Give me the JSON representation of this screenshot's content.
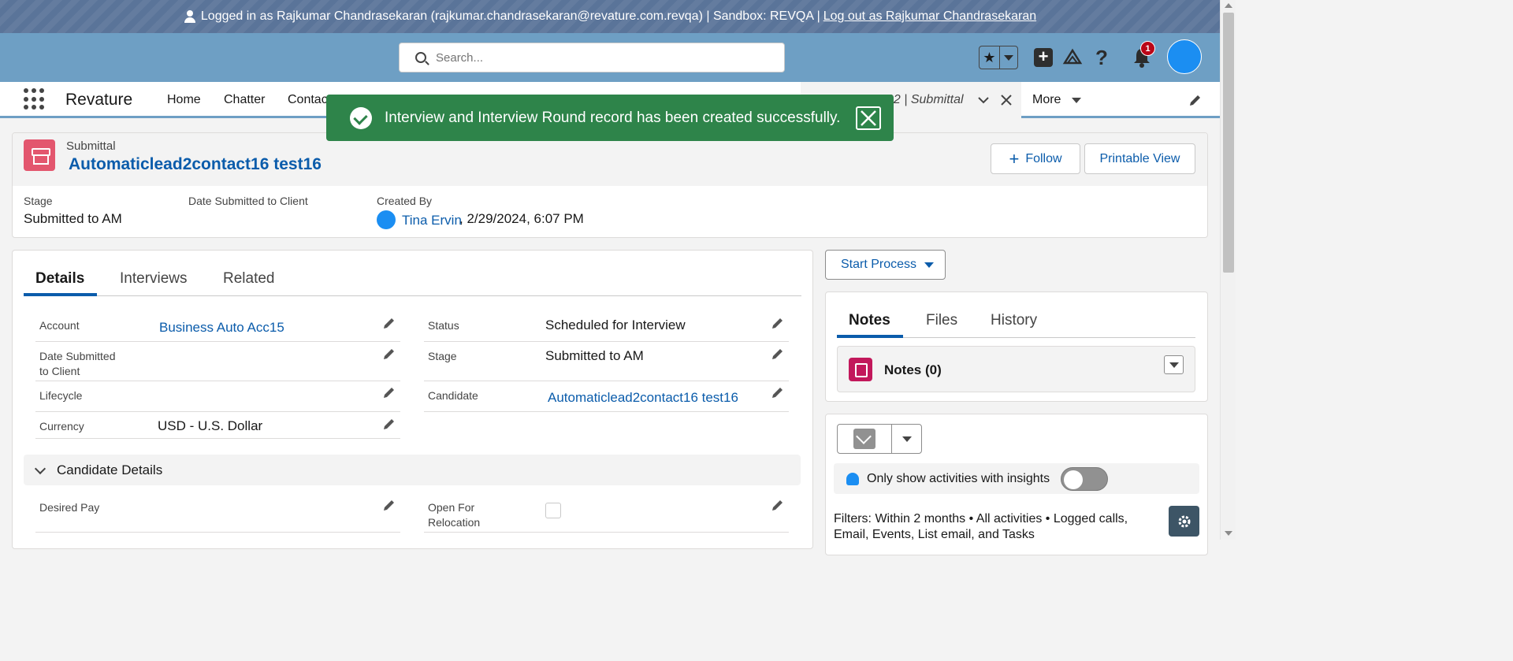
{
  "banner": {
    "text": "Logged in as Rajkumar Chandrasekaran (rajkumar.chandrasekaran@revature.com.revqa) | Sandbox: REVQA |",
    "logout": "Log out as Rajkumar Chandrasekaran"
  },
  "header": {
    "search_placeholder": "Search...",
    "notification_count": "1"
  },
  "nav": {
    "app_name": "Revature",
    "items": [
      "Home",
      "Chatter",
      "Contac"
    ],
    "active_tab": "02 | Submittal",
    "more": "More"
  },
  "toast": {
    "message": "Interview and Interview Round record has been created successfully."
  },
  "record": {
    "type": "Submittal",
    "name": "Automaticlead2contact16 test16",
    "follow": "Follow",
    "printable": "Printable View",
    "highlights": {
      "stage_label": "Stage",
      "stage_value": "Submitted to AM",
      "date_label": "Date Submitted to Client",
      "created_label": "Created By",
      "created_by": "Tina Ervin",
      "created_at": ", 2/29/2024, 6:07 PM"
    }
  },
  "tabs": [
    "Details",
    "Interviews",
    "Related"
  ],
  "details": {
    "account_label": "Account",
    "account_value": "Business Auto Acc15",
    "date_submitted_label_1": "Date Submitted",
    "date_submitted_label_2": "to Client",
    "lifecycle_label": "Lifecycle",
    "currency_label": "Currency",
    "currency_value": "USD - U.S. Dollar",
    "status_label": "Status",
    "status_value": "Scheduled for Interview",
    "stage_label": "Stage",
    "stage_value": "Submitted to AM",
    "candidate_label": "Candidate",
    "candidate_value": "Automaticlead2contact16 test16"
  },
  "candidate_section": {
    "title": "Candidate Details",
    "desired_pay_label": "Desired Pay",
    "relocation_label_1": "Open For",
    "relocation_label_2": "Relocation"
  },
  "right": {
    "start_process": "Start Process",
    "tabs": [
      "Notes",
      "Files",
      "History"
    ],
    "notes_title": "Notes (0)",
    "insights_label": "Only show activities with insights",
    "filters_line1": "Filters: Within 2 months • All activities • Logged calls,",
    "filters_line2": "Email, Events, List email, and Tasks"
  },
  "colors": {
    "banner": "#5a7499",
    "header": "#6e9fc4",
    "toast": "#2e844a",
    "link": "#0b5cab",
    "record_icon": "#e3566e"
  }
}
